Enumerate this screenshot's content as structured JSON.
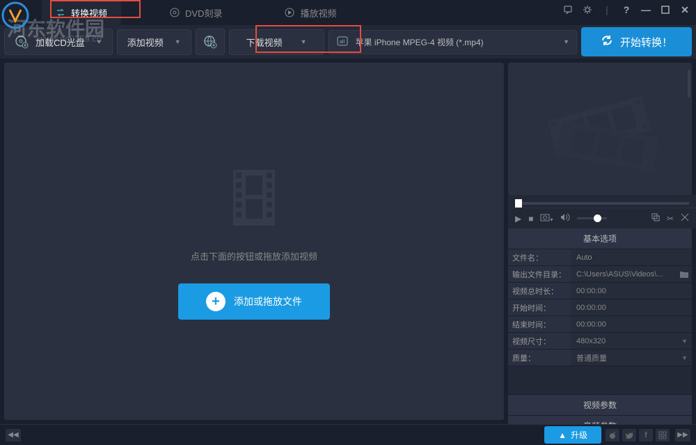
{
  "watermark": {
    "main": "河东软件园",
    "sub": "www.pc0359.cn"
  },
  "tabs": {
    "convert": "转换视频",
    "dvd": "DVD刻录",
    "play": "播放视频"
  },
  "toolbar": {
    "load_cd": "加载CD光盘",
    "add_video": "添加视频",
    "download_video": "下载视频",
    "format_label": "苹果 iPhone MPEG-4 视频 (*.mp4)",
    "convert": "开始转换！"
  },
  "main": {
    "hint": "点击下面的按钮或拖放添加视频",
    "add_btn": "添加或拖放文件"
  },
  "options": {
    "basic_header": "基本选项",
    "filename_label": "文件名：",
    "filename_value": "Auto",
    "output_label": "输出文件目录：",
    "output_value": "C:\\Users\\ASUS\\Videos\\...",
    "total_duration_label": "视频总时长：",
    "total_duration_value": "00:00:00",
    "start_time_label": "开始时间：",
    "start_time_value": "00:00:00",
    "end_time_label": "结束时间：",
    "end_time_value": "00:00:00",
    "video_size_label": "视频尺寸：",
    "video_size_value": "480x320",
    "quality_label": "质量：",
    "quality_value": "普通质量",
    "video_params_header": "视频参数",
    "audio_params_header": "音频参数"
  },
  "bottom": {
    "upgrade": "升级"
  }
}
